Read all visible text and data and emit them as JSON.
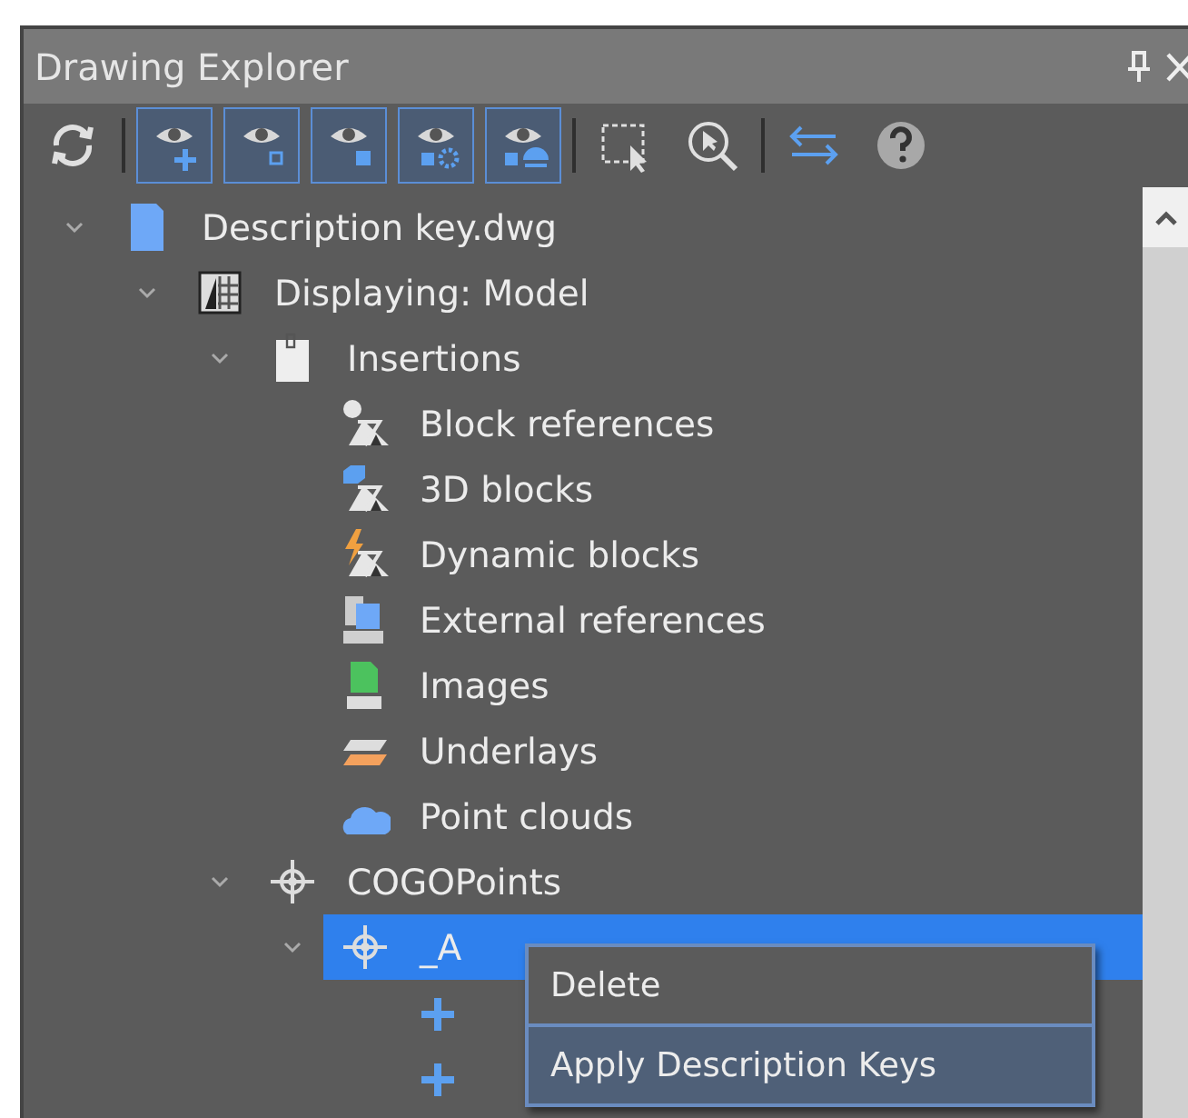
{
  "panel": {
    "title": "Drawing Explorer"
  },
  "toolbar": [
    {
      "kind": "refresh"
    },
    {
      "kind": "separator"
    },
    {
      "kind": "eye-add",
      "selected": true
    },
    {
      "kind": "eye-outline",
      "selected": true
    },
    {
      "kind": "eye-solid",
      "selected": true
    },
    {
      "kind": "eye-gear",
      "selected": true
    },
    {
      "kind": "eye-half",
      "selected": true
    },
    {
      "kind": "separator"
    },
    {
      "kind": "select",
      "selected": false
    },
    {
      "kind": "zoom",
      "selected": false
    },
    {
      "kind": "separator"
    },
    {
      "kind": "swap",
      "selected": false
    },
    {
      "kind": "help",
      "selected": false
    }
  ],
  "tree": [
    {
      "label": "Description key.dwg",
      "kind": "file",
      "expanded": true,
      "selected": false,
      "children": [
        {
          "label": "Displaying: Model",
          "kind": "model",
          "expanded": true,
          "selected": false,
          "children": [
            {
              "label": "Insertions",
              "kind": "insertions",
              "expanded": true,
              "selected": false,
              "children": [
                {
                  "label": "Block references",
                  "kind": "block",
                  "selected": false
                },
                {
                  "label": "3D blocks",
                  "kind": "block3d",
                  "selected": false
                },
                {
                  "label": "Dynamic blocks",
                  "kind": "dynamic",
                  "selected": false
                },
                {
                  "label": "External references",
                  "kind": "xref",
                  "selected": false
                },
                {
                  "label": "Images",
                  "kind": "image",
                  "selected": false
                },
                {
                  "label": "Underlays",
                  "kind": "underlay",
                  "selected": false
                },
                {
                  "label": "Point clouds",
                  "kind": "cloud",
                  "selected": false
                }
              ]
            },
            {
              "label": "COGOPoints",
              "kind": "point",
              "expanded": true,
              "selected": false,
              "children": [
                {
                  "label": "_A",
                  "kind": "point",
                  "expanded": true,
                  "selected": true,
                  "children": [
                    {
                      "kind": "plus",
                      "selected": false
                    },
                    {
                      "kind": "plus",
                      "selected": false
                    }
                  ]
                }
              ]
            }
          ]
        }
      ]
    }
  ],
  "context_menu": [
    {
      "label": "Delete",
      "selected": false
    },
    {
      "label": "Apply Description Keys",
      "selected": true
    }
  ]
}
